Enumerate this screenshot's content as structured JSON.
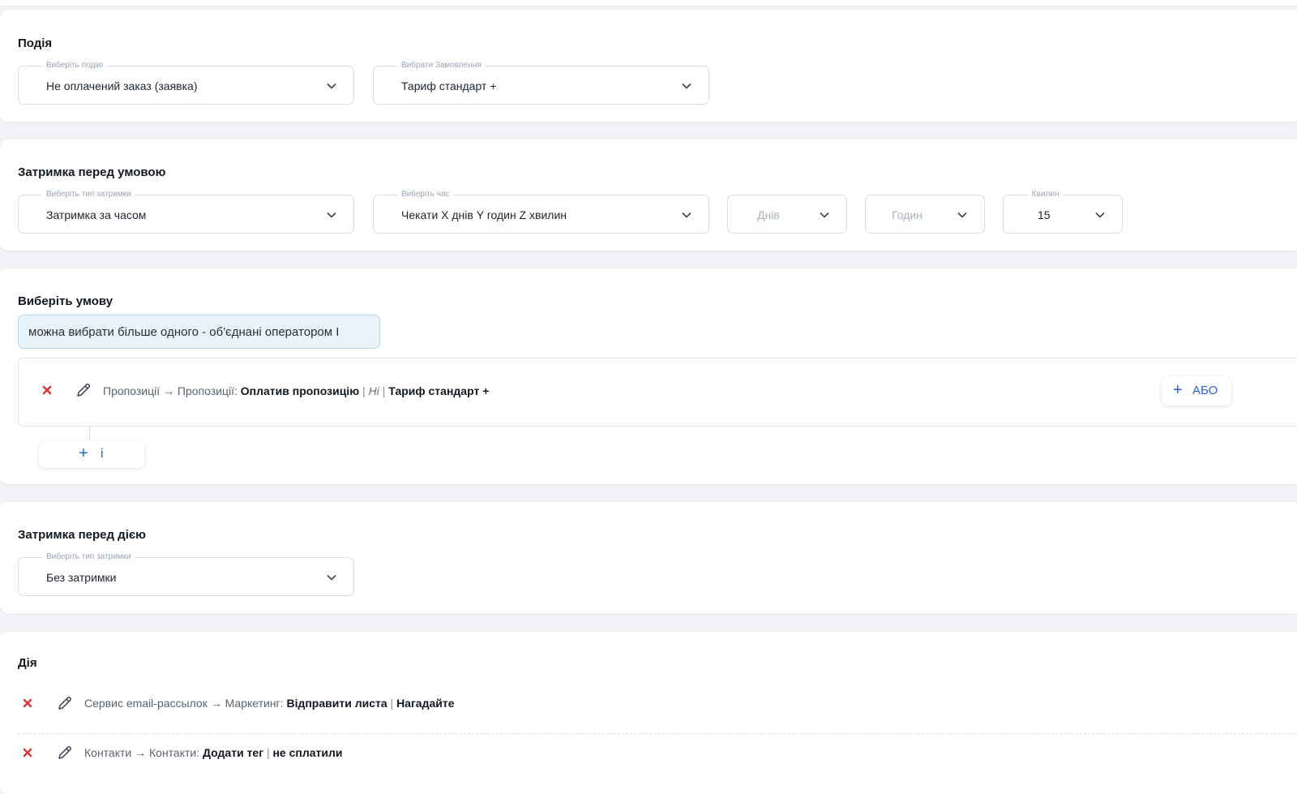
{
  "event_section": {
    "title": "Подія",
    "event_field": {
      "label": "Виберіть подію",
      "value": "Не оплачений заказ (заявка)"
    },
    "order_field": {
      "label": "Вибрати Замовлення",
      "value": "Тариф стандарт +"
    }
  },
  "delay_before_condition": {
    "title": "Затримка перед умовою",
    "type_field": {
      "label": "Виберіть тип затримки",
      "value": "Затримка за часом"
    },
    "time_field": {
      "label": "Виберіть час",
      "value": "Чекати X днів Y годин Z хвилин"
    },
    "days_field": {
      "placeholder": "Днів"
    },
    "hours_field": {
      "placeholder": "Годин"
    },
    "minutes_field": {
      "label": "Хвилин",
      "value": "15"
    }
  },
  "condition_section": {
    "title": "Виберіть умову",
    "hint": "можна вибрати більше одного - об'єднані оператором I",
    "rule": {
      "path": "Пропозиції → Пропозиції:",
      "action": "Оплатив пропозицію",
      "negation": "Ні",
      "target": "Тариф стандарт +"
    },
    "or_button": "АБО",
    "and_button": "і"
  },
  "delay_before_action": {
    "title": "Затримка перед дією",
    "type_field": {
      "label": "Виберіть тип затримки",
      "value": "Без затримки"
    }
  },
  "action_section": {
    "title": "Дія",
    "items": [
      {
        "path": "Сервис email-рассылок → Маркетинг:",
        "action": "Відправити листа",
        "target": "Нагадайте"
      },
      {
        "path": "Контакти → Контакти:",
        "action": "Додати тег",
        "target": "не сплатили"
      }
    ]
  },
  "colors": {
    "accent": "#2b5fd6",
    "delete": "#e03131",
    "input_highlight": "#eaf3fb"
  }
}
